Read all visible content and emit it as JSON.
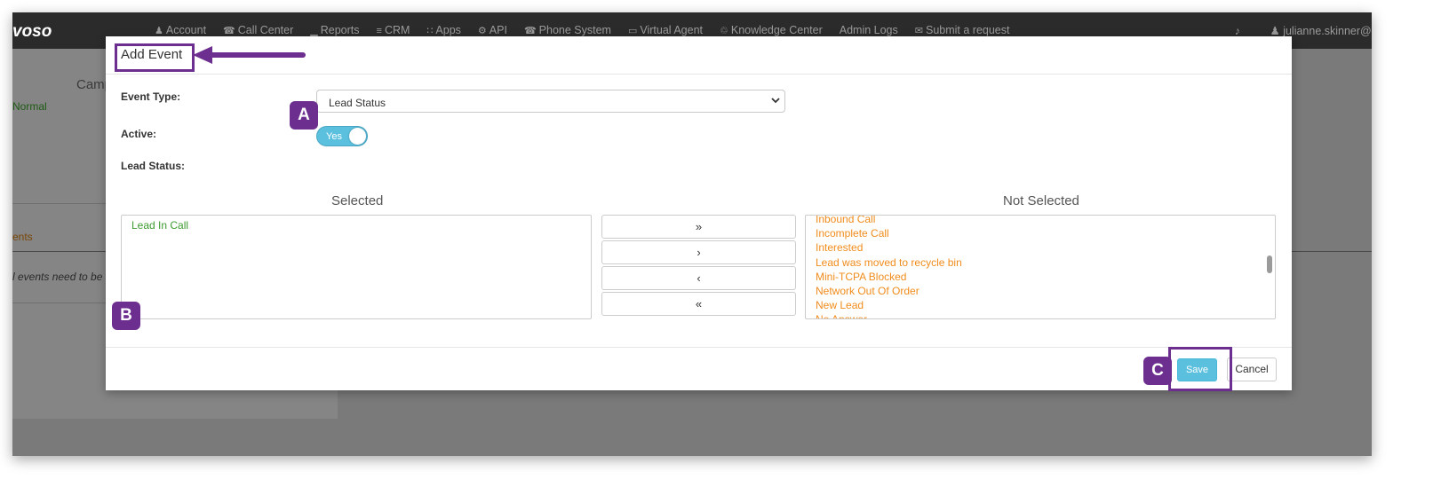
{
  "topnav": {
    "logo": "voso",
    "items": [
      {
        "icon": "user-icon",
        "glyph": "♟",
        "label": "Account"
      },
      {
        "icon": "phone-icon",
        "glyph": "☎",
        "label": "Call Center"
      },
      {
        "icon": "bar-chart-icon",
        "glyph": "▁",
        "label": "Reports"
      },
      {
        "icon": "list-icon",
        "glyph": "≡",
        "label": "CRM"
      },
      {
        "icon": "grid-icon",
        "glyph": "∷",
        "label": "Apps"
      },
      {
        "icon": "gear-icon",
        "glyph": "⚙",
        "label": "API"
      },
      {
        "icon": "phone-icon",
        "glyph": "☎",
        "label": "Phone System"
      },
      {
        "icon": "monitor-icon",
        "glyph": "▭",
        "label": "Virtual Agent"
      },
      {
        "icon": "lightbulb-icon",
        "glyph": "♲",
        "label": "Knowledge Center"
      },
      {
        "icon": "none",
        "glyph": "",
        "label": "Admin Logs"
      },
      {
        "icon": "ticket-icon",
        "glyph": "✉",
        "label": "Submit a request"
      }
    ],
    "user": "julianne.skinner@c",
    "bell_glyph": "♪",
    "user_glyph": "♟"
  },
  "background": {
    "campaign_heading": "Camp",
    "status_text": "Normal",
    "events_tab": "ents",
    "note_text": "l events need to be m"
  },
  "modal": {
    "title": "Add Event",
    "event_type_label": "Event Type:",
    "event_type_value": "Lead Status",
    "active_label": "Active:",
    "active_value": "Yes",
    "lead_status_label": "Lead Status:",
    "selected_heading": "Selected",
    "not_selected_heading": "Not Selected",
    "selected_items": [
      "Lead In Call"
    ],
    "not_selected_items": [
      "Inbound Call",
      "Incomplete Call",
      "Interested",
      "Lead was moved to recycle bin",
      "Mini-TCPA Blocked",
      "Network Out Of Order",
      "New Lead",
      "No Answer"
    ],
    "move_buttons": [
      "»",
      "›",
      "‹",
      "«"
    ],
    "save_label": "Save",
    "cancel_label": "Cancel"
  },
  "annotations": {
    "badge_a": "A",
    "badge_b": "B",
    "badge_c": "C"
  },
  "colors": {
    "annotation_purple": "#6c2f8f",
    "accent_blue": "#5bc0de",
    "selected_green": "#3c9a2e",
    "not_selected_orange": "#f08c1b"
  }
}
